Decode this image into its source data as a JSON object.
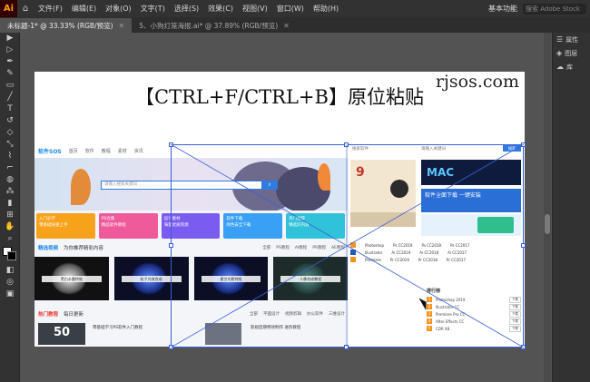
{
  "app": {
    "logo": "Ai",
    "menu": [
      "文件(F)",
      "编辑(E)",
      "对象(O)",
      "文字(T)",
      "选择(S)",
      "效果(C)",
      "视图(V)",
      "窗口(W)",
      "帮助(H)"
    ],
    "workspace": "基本功能",
    "stock_search_placeholder": "搜索 Adobe Stock"
  },
  "tabs": [
    {
      "label": "未标题-1* @ 33.33% (RGB/预览)",
      "active": true
    },
    {
      "label": "5、小狗灯笼海报.ai* @ 37.89% (RGB/预览)",
      "active": false
    }
  ],
  "panels": [
    {
      "icon": "properties-icon",
      "label": "属性"
    },
    {
      "icon": "layers-icon",
      "label": "图层"
    },
    {
      "icon": "libraries-icon",
      "label": "库"
    }
  ],
  "artboard": {
    "site_brand": "rjsos.com",
    "title": "【CTRL+F/CTRL+B】原位粘贴"
  },
  "pasted_site": {
    "logo": "软件SOS",
    "nav": [
      "首页",
      "软件",
      "教程",
      "素材",
      "资讯"
    ],
    "nav_search": "",
    "hero_search_placeholder": "请输入搜索关键词",
    "cards": [
      {
        "title": "入门必学",
        "sub": "零基础快速上手",
        "color": "#f7a21b"
      },
      {
        "title": "PS合集",
        "sub": "精品软件教程",
        "color": "#ef5a9b"
      },
      {
        "title": "设计素材",
        "sub": "海量优质资源",
        "color": "#7b5cf0"
      },
      {
        "title": "软件下载",
        "sub": "绿色安全下载",
        "color": "#3aa0f4"
      },
      {
        "title": "热门推荐",
        "sub": "精选好内容",
        "color": "#30c2d8"
      }
    ],
    "section1": {
      "title": "精选视频",
      "sub": "为你推荐精彩内容",
      "tabs": [
        "全部",
        "PS教程",
        "AI教程",
        "PR教程",
        "AE教程"
      ]
    },
    "thumbs": [
      "黑白水墨特效",
      "粒子光效合成",
      "星空光影特效",
      "人像合成教程"
    ],
    "section2": {
      "title": "热门教程",
      "sub": "每日更新",
      "tabs": [
        "全部",
        "平面设计",
        "视频剪辑",
        "办公软件",
        "三维设计"
      ]
    },
    "row3": {
      "badge": "50",
      "text1": "零基础学习PS软件入门教程",
      "text2": "影视后期特效制作 进阶教程"
    },
    "right": {
      "search_label": "搜索软件",
      "search2": "请输入关键词",
      "btn": "搜索",
      "book_num": "9",
      "banner1": "MAC",
      "banner2": "软件全面下载 一键安装",
      "soft_rows": [
        {
          "name": "Photoshop",
          "a": "Ps CC2019",
          "b": "Ps CC2018",
          "c": "Ps CC2017"
        },
        {
          "name": "Illustrator",
          "a": "Ai CC2019",
          "b": "Ai CC2018",
          "c": "Ai CC2017"
        },
        {
          "name": "Premiere",
          "a": "Pr CC2019",
          "b": "Pr CC2018",
          "c": "Pr CC2017"
        }
      ],
      "rank_title": "排行榜",
      "ranks": [
        {
          "n": "1",
          "name": "Photoshop 2019",
          "dl": "下载"
        },
        {
          "n": "2",
          "name": "Illustrator CC",
          "dl": "下载"
        },
        {
          "n": "3",
          "name": "Premiere Pro CC",
          "dl": "下载"
        },
        {
          "n": "4",
          "name": "After Effects CC",
          "dl": "下载"
        },
        {
          "n": "5",
          "name": "CDR X8",
          "dl": "下载"
        }
      ]
    }
  }
}
